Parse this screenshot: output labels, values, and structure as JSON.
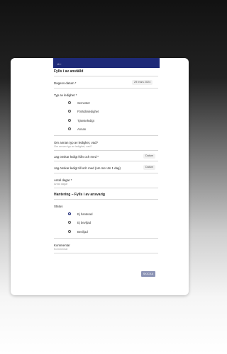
{
  "header": {
    "back_icon": "arrow-left-icon"
  },
  "form": {
    "title": "Fylls i av anställd",
    "date_label": "Dagens datum",
    "date_value": "29 mars 2024",
    "leave_type_label": "Typ av ledighet",
    "leave_types": [
      "Semester",
      "Föräldraledighet",
      "Tjänsteledigt",
      "Annan"
    ],
    "other_type_label": "Om annan typ av ledighet, vad?",
    "other_type_placeholder": "Om annan typ av ledighet, vad?",
    "from_label": "Jag önskar ledigt från och med",
    "from_value": "Datum",
    "to_label": "Jag önskar ledigt till och med (om mer än 1 dag)",
    "to_value": "Datum",
    "days_label": "Antal dagar",
    "days_placeholder": "Antal dagar",
    "required_mark": "*"
  },
  "handling": {
    "title": "Hantering – Fylls i av ansvarig",
    "status_label": "Status",
    "statuses": [
      "Ej hanterad",
      "Ej beviljad",
      "Beviljad"
    ],
    "selected_status_index": 0,
    "comment_label": "Kommentar",
    "comment_placeholder": "Kommentar",
    "submit_label": "SKICKA"
  },
  "colors": {
    "accent": "#1e2a78",
    "submit": "#8b93b5"
  }
}
